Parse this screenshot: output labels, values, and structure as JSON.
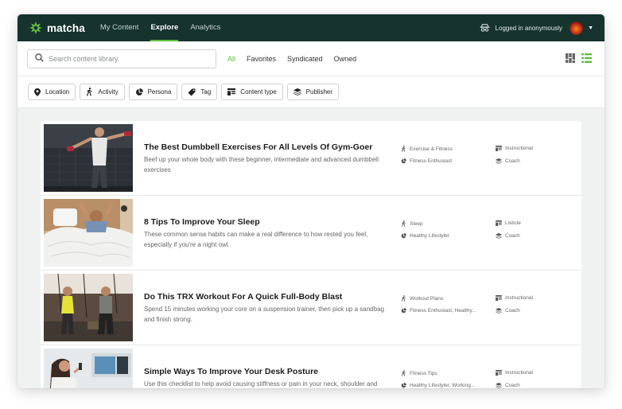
{
  "app": {
    "name": "matcha"
  },
  "nav": {
    "items": [
      {
        "label": "My Content"
      },
      {
        "label": "Explore"
      },
      {
        "label": "Analytics"
      }
    ]
  },
  "user": {
    "status": "Logged in anonymously"
  },
  "search": {
    "placeholder": "Search content library"
  },
  "filters": [
    {
      "label": "All"
    },
    {
      "label": "Favorites"
    },
    {
      "label": "Syndicated"
    },
    {
      "label": "Owned"
    }
  ],
  "facets": [
    {
      "label": "Location",
      "icon": "location-pin-icon"
    },
    {
      "label": "Activity",
      "icon": "walking-person-icon"
    },
    {
      "label": "Persona",
      "icon": "pie-chart-icon"
    },
    {
      "label": "Tag",
      "icon": "tag-icon"
    },
    {
      "label": "Content type",
      "icon": "content-type-icon"
    },
    {
      "label": "Publisher",
      "icon": "layers-icon"
    }
  ],
  "colors": {
    "topbar": "#16332e",
    "accent": "#5fbf3a"
  },
  "items": [
    {
      "title": "The Best Dumbbell Exercises For All Levels Of Gym-Goer",
      "description": "Beef up your whole body with these beginner, intermediate and advanced dumbbell exercises",
      "activity": "Exercise & Fitness",
      "persona": "Fitness Enthusiast",
      "content_type": "Instructional",
      "publisher": "Coach"
    },
    {
      "title": "8 Tips To Improve Your Sleep",
      "description": "These common sense habits can make a real difference to how rested you feel, especially if you're a night owl.",
      "activity": "Sleep",
      "persona": "Healthy Lifestyler",
      "content_type": "Listicle",
      "publisher": "Coach"
    },
    {
      "title": "Do This TRX Workout For A Quick Full-Body Blast",
      "description": "Spend 15 minutes working your core on a suspension trainer, then pick up a sandbag and finish strong.",
      "activity": "Workout Plans",
      "persona": "Fitness Enthusiast, Healthy...",
      "content_type": "Instructional",
      "publisher": "Coach"
    },
    {
      "title": "Simple Ways To Improve Your Desk Posture",
      "description": "Use this checklist to help avoid causing stiffness or pain in your neck, shoulder and",
      "activity": "Fitness Tips",
      "persona": "Healthy Lifestyler, Working...",
      "content_type": "Instructional",
      "publisher": "Coach"
    }
  ]
}
